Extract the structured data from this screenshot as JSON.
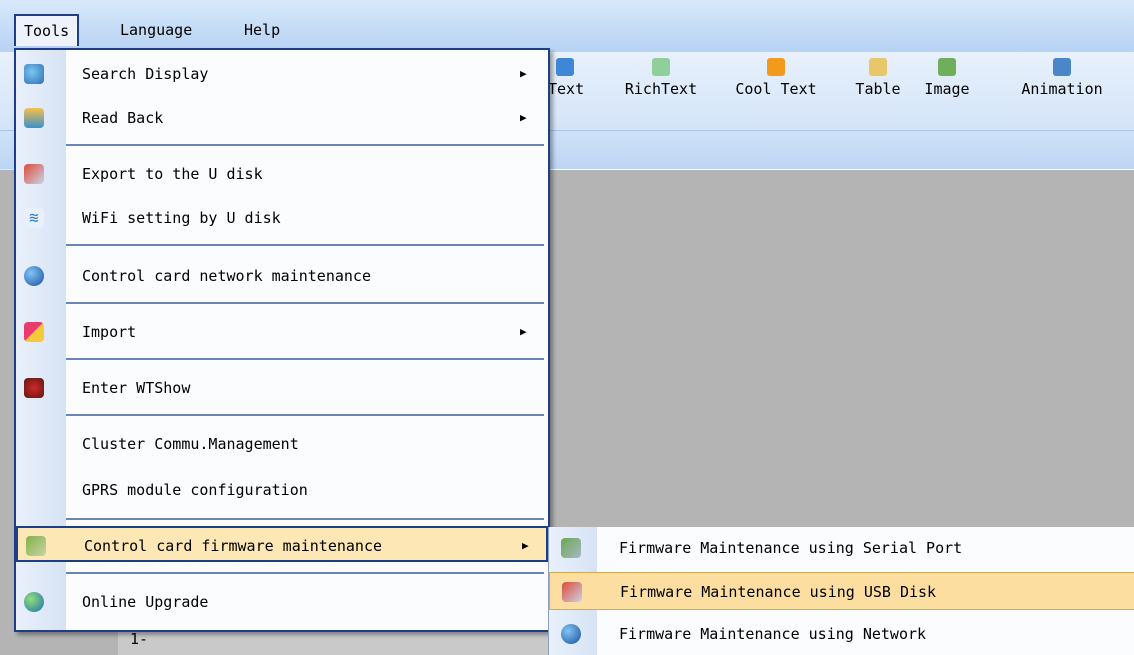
{
  "menubar": {
    "tools": "Tools",
    "language": "Language",
    "help": "Help"
  },
  "toolbar": {
    "items": [
      "Text",
      "RichText",
      "Cool Text",
      "Table",
      "Image",
      "Animation"
    ]
  },
  "row_label": "1-",
  "tools_menu": {
    "search_display": "Search Display",
    "read_back": "Read Back",
    "export_u_disk": "Export to the U disk",
    "wifi_u_disk": "WiFi setting by U disk",
    "network_maintenance": "Control card network maintenance",
    "import": "Import",
    "enter_wtshow": "Enter WTShow",
    "cluster": "Cluster Commu.Management",
    "gprs": "GPRS module configuration",
    "firmware": "Control card firmware maintenance",
    "online_upgrade": "Online Upgrade"
  },
  "submenu": {
    "serial": "Firmware Maintenance using Serial Port",
    "usb": "Firmware Maintenance using USB Disk",
    "network": "Firmware Maintenance using Network"
  },
  "icons": {
    "search_display": "magnifier-icon",
    "read_back": "read-back-icon",
    "export": "usb-stick-icon",
    "wifi": "wifi-icon",
    "network": "globe-icon",
    "import": "import-icon",
    "wtshow": "mask-icon",
    "firmware": "wrench-icon",
    "online_upgrade": "globe-upgrade-icon"
  },
  "colors": {
    "menu_border": "#1f3e8a",
    "highlight": "#fce7b5",
    "canvas": "#b4b4b4"
  }
}
